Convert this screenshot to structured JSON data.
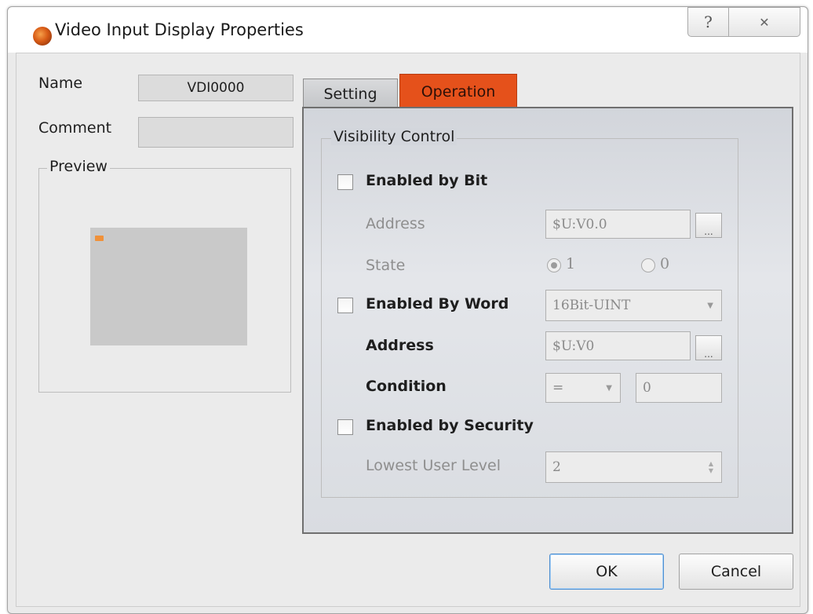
{
  "window": {
    "title": "Video Input Display Properties",
    "help_glyph": "?",
    "close_glyph": "✕"
  },
  "object": {
    "name_label": "Name",
    "name_value": "VDI0000",
    "comment_label": "Comment",
    "comment_value": ""
  },
  "preview": {
    "title": "Preview"
  },
  "tabs": [
    {
      "label": "Setting",
      "active": false
    },
    {
      "label": "Operation",
      "active": true,
      "color": "#e5511b"
    }
  ],
  "visibility": {
    "group_title": "Visibility Control",
    "enabled_by_bit": {
      "label": "Enabled by Bit",
      "checked": false,
      "address_label": "Address",
      "address_value": "$U:V0.0",
      "browse_label": "...",
      "state_label": "State",
      "state_options": [
        "1",
        "0"
      ],
      "state_selected": "1"
    },
    "enabled_by_word": {
      "label": "Enabled By Word",
      "checked": false,
      "type_value": "16Bit-UINT",
      "address_label": "Address",
      "address_value": "$U:V0",
      "browse_label": "...",
      "condition_label": "Condition",
      "condition_operator": "=",
      "condition_value": "0"
    },
    "enabled_by_security": {
      "label": "Enabled by Security",
      "checked": false,
      "lowest_level_label": "Lowest User Level",
      "lowest_level_value": "2"
    }
  },
  "buttons": {
    "ok_label": "OK",
    "cancel_label": "Cancel"
  },
  "colors": {
    "accent_tab": "#e5511b",
    "preview_widget": "#c9c9c9"
  }
}
